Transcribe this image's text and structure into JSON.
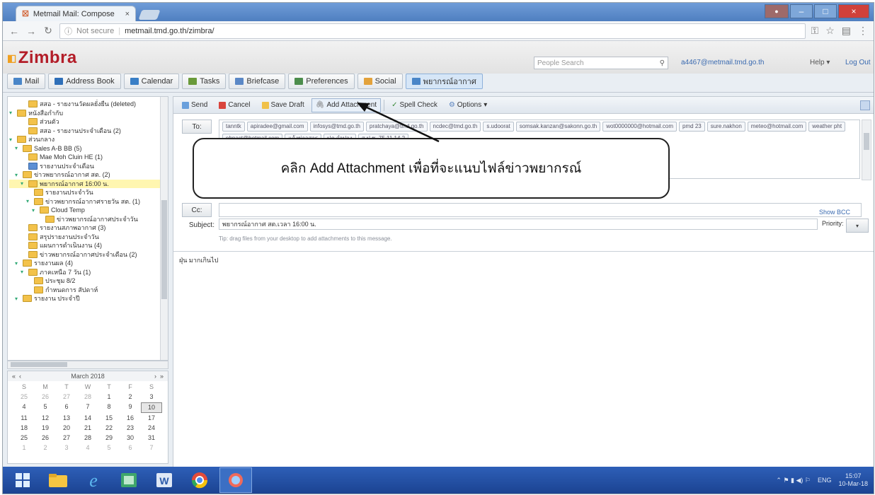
{
  "browser": {
    "tab_title": "Metmail Mail: Compose",
    "url_prefix": "Not secure",
    "url": "metmail.tmd.go.th/zimbra/"
  },
  "zimbra": {
    "logo": "Zimbra",
    "search_placeholder": "People Search",
    "user_email": "a4467@metmail.tmd.go.th",
    "help_label": "Help",
    "logout_label": "Log Out",
    "app_tabs": [
      "Mail",
      "Address Book",
      "Calendar",
      "Tasks",
      "Briefcase",
      "Preferences",
      "Social",
      "พยากรณ์อากาศ"
    ]
  },
  "folders": [
    {
      "label": "สสอ - รายงานวัดผลยั่งยืน (deleted)",
      "level": 2,
      "arrow": "",
      "selected": false
    },
    {
      "label": "หนังสือกำกับ",
      "level": 0,
      "arrow": "▾",
      "selected": false
    },
    {
      "label": "ส่วนตัว",
      "level": 2,
      "arrow": "",
      "selected": false
    },
    {
      "label": "สสอ - รายงานประจำเดือน (2)",
      "level": 2,
      "arrow": "",
      "selected": false
    },
    {
      "label": "ส่วนกลาง",
      "level": 0,
      "arrow": "▾",
      "selected": false
    },
    {
      "label": "Sales A-B BB (5)",
      "level": 1,
      "arrow": "▾",
      "selected": false
    },
    {
      "label": "Mae Moh Cluin HE (1)",
      "level": 2,
      "arrow": "",
      "selected": false
    },
    {
      "label": "รายงานประจำเดือน",
      "level": 2,
      "arrow": "",
      "selected": false,
      "blue": true
    },
    {
      "label": "ข่าวพยากรณ์อากาศ สต. (2)",
      "level": 1,
      "arrow": "▾",
      "selected": false
    },
    {
      "label": "พยากรณ์อากาศ 16:00 น.",
      "level": 2,
      "arrow": "▾",
      "selected": true
    },
    {
      "label": "รายงานประจำวัน",
      "level": 3,
      "arrow": "",
      "selected": false
    },
    {
      "label": "ข่าวพยากรณ์อากาศรายวัน สต. (1)",
      "level": 3,
      "arrow": "▾",
      "selected": false
    },
    {
      "label": "Cloud Temp",
      "level": 4,
      "arrow": "▾",
      "selected": false
    },
    {
      "label": "ข่าวพยากรณ์อากาศประจำวัน",
      "level": 5,
      "arrow": "",
      "selected": false
    },
    {
      "label": "รายงานสภาพอากาศ (3)",
      "level": 2,
      "arrow": "",
      "selected": false
    },
    {
      "label": "สรุปรายงานประจำวัน",
      "level": 2,
      "arrow": "",
      "selected": false
    },
    {
      "label": "แผนการดำเนินงาน (4)",
      "level": 2,
      "arrow": "",
      "selected": false
    },
    {
      "label": "ข่าวพยากรณ์อากาศประจำเดือน (2)",
      "level": 2,
      "arrow": "",
      "selected": false
    },
    {
      "label": "รายงานผล (4)",
      "level": 1,
      "arrow": "▾",
      "selected": false
    },
    {
      "label": "ภาคเหนือ 7 วัน (1)",
      "level": 2,
      "arrow": "▾",
      "selected": false
    },
    {
      "label": "ประชุม 8/2",
      "level": 3,
      "arrow": "",
      "selected": false
    },
    {
      "label": "กำหนดการ สัปดาห์",
      "level": 3,
      "arrow": "",
      "selected": false
    },
    {
      "label": "รายงาน ประจำปี",
      "level": 1,
      "arrow": "▾",
      "selected": false
    }
  ],
  "calendar": {
    "title": "March 2018",
    "nav_prev2": "«",
    "nav_prev": "‹",
    "nav_next": "›",
    "nav_next2": "»",
    "dow": [
      "S",
      "M",
      "T",
      "W",
      "T",
      "F",
      "S"
    ],
    "cells": [
      {
        "d": "25",
        "o": true
      },
      {
        "d": "26",
        "o": true
      },
      {
        "d": "27",
        "o": true
      },
      {
        "d": "28",
        "o": true
      },
      {
        "d": "1"
      },
      {
        "d": "2"
      },
      {
        "d": "3"
      },
      {
        "d": "4"
      },
      {
        "d": "5"
      },
      {
        "d": "6"
      },
      {
        "d": "7"
      },
      {
        "d": "8"
      },
      {
        "d": "9"
      },
      {
        "d": "10",
        "t": true
      },
      {
        "d": "11"
      },
      {
        "d": "12"
      },
      {
        "d": "13"
      },
      {
        "d": "14"
      },
      {
        "d": "15"
      },
      {
        "d": "16"
      },
      {
        "d": "17"
      },
      {
        "d": "18"
      },
      {
        "d": "19"
      },
      {
        "d": "20"
      },
      {
        "d": "21"
      },
      {
        "d": "22"
      },
      {
        "d": "23"
      },
      {
        "d": "24"
      },
      {
        "d": "25"
      },
      {
        "d": "26"
      },
      {
        "d": "27"
      },
      {
        "d": "28"
      },
      {
        "d": "29"
      },
      {
        "d": "30"
      },
      {
        "d": "31"
      },
      {
        "d": "1",
        "o": true
      },
      {
        "d": "2",
        "o": true
      },
      {
        "d": "3",
        "o": true
      },
      {
        "d": "4",
        "o": true
      },
      {
        "d": "5",
        "o": true
      },
      {
        "d": "6",
        "o": true
      },
      {
        "d": "7",
        "o": true
      }
    ]
  },
  "compose": {
    "send": "Send",
    "cancel": "Cancel",
    "save_draft": "Save Draft",
    "add_attachment": "Add Attachment",
    "spell_check": "Spell Check",
    "options": "Options",
    "to_label": "To:",
    "cc_label": "Cc:",
    "show_bcc": "Show BCC",
    "subject_label": "Subject:",
    "subject_value": "พยากรณ์อากาศ สต.เวลา 16:00 น.",
    "priority_label": "Priority:",
    "drag_tip": "Tip: drag files from your desktop to add attachments to this message.",
    "body_text": "ฝุ่น มากเกินไป",
    "recipients": [
      "tanntk",
      "apiradee@gmail.com",
      "infosys@tmd.go.th",
      "pratchaya@tmd.go.th",
      "ncdec@tmd.go.th",
      "s.udoorat",
      "somsak.kanzan@sakonn.go.th",
      "wot0000000@hotmail.com",
      "pmd 23",
      "sure.nakhon",
      "meteo@hotmail.com",
      "weather pht",
      "phpact@hotmail.com",
      "แจ้งข่าวสาร",
      "ปภ.ลำปาง",
      "ส.ป.ช. 75 11 14.2"
    ]
  },
  "callout": {
    "text": "คลิก Add Attachment เพื่อที่จะแนบไฟล์ข่าวพยากรณ์"
  },
  "tray": {
    "lang": "ENG",
    "time": "15:07",
    "date": "10-Mar-18"
  }
}
